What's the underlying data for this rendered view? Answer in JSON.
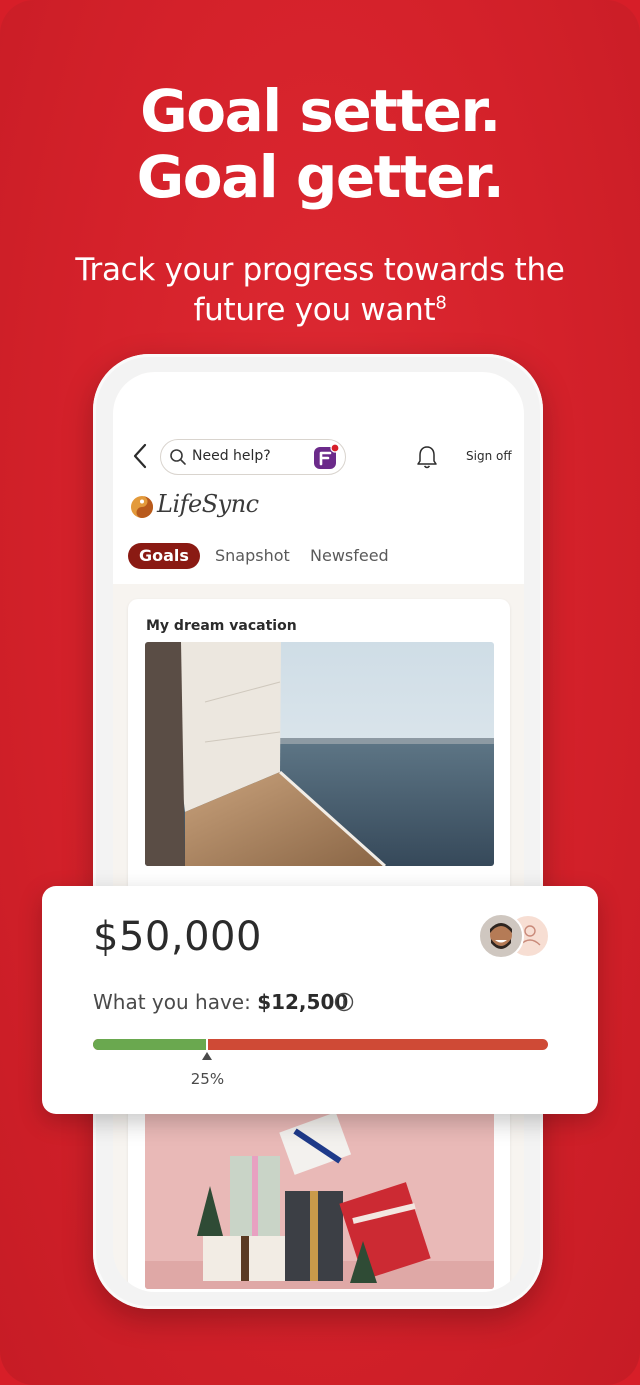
{
  "headline": {
    "line1": "Goal setter.",
    "line2": "Goal getter."
  },
  "subhead": {
    "line1": "Track your progress towards the",
    "line2": "future you want",
    "footnote": "8"
  },
  "app": {
    "search_placeholder": "Need help?",
    "sign_off": "Sign off",
    "brand": "LifeSync",
    "tabs": [
      {
        "label": "Goals",
        "active": true
      },
      {
        "label": "Snapshot",
        "active": false
      },
      {
        "label": "Newsfeed",
        "active": false
      }
    ]
  },
  "goal_card": {
    "title": "My dream vacation"
  },
  "goal_summary": {
    "target": "$50,000",
    "have_label": "What you have:",
    "have_value": "$12,500",
    "progress_fraction": 0.25,
    "progress_label": "25%"
  },
  "colors": {
    "brand_red": "#d71e28",
    "active_tab": "#8a1a13",
    "progress_good": "#6aa84f",
    "progress_rest": "#cf4a36"
  },
  "icons": [
    "back-icon",
    "search-icon",
    "assistant-icon",
    "bell-icon",
    "brand-logo-icon",
    "info-icon",
    "avatar",
    "person-icon"
  ]
}
